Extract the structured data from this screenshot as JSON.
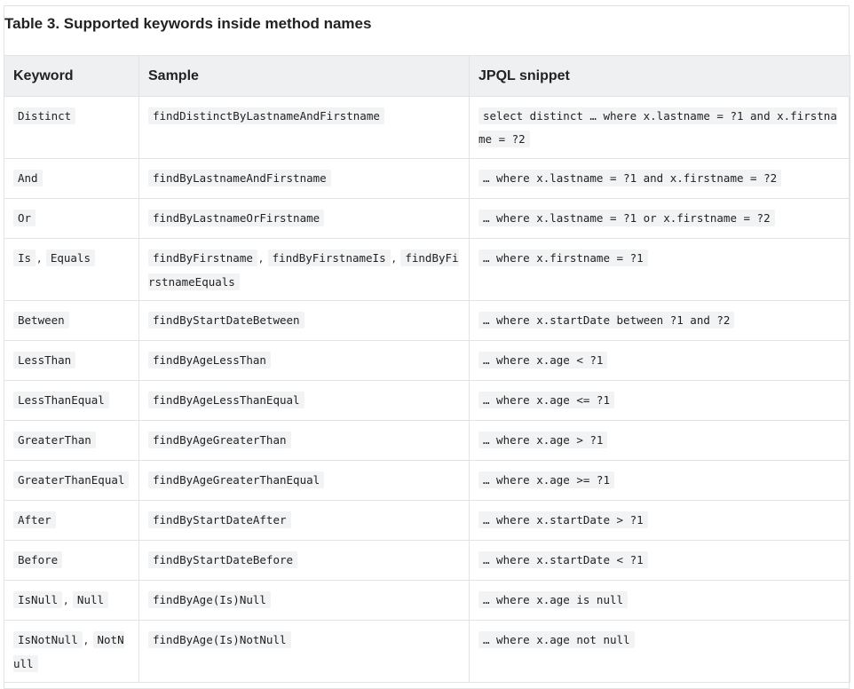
{
  "caption": "Table 3. Supported keywords inside method names",
  "headers": {
    "keyword": "Keyword",
    "sample": "Sample",
    "jpql": "JPQL snippet"
  },
  "rows": [
    {
      "keyword": [
        "Distinct"
      ],
      "sample": [
        "findDistinctByLastnameAndFirstname"
      ],
      "jpql": [
        "select distinct … where x.lastname = ?1 and x.firstname = ?2"
      ]
    },
    {
      "keyword": [
        "And"
      ],
      "sample": [
        "findByLastnameAndFirstname"
      ],
      "jpql": [
        "… where x.lastname = ?1 and x.firstname = ?2"
      ]
    },
    {
      "keyword": [
        "Or"
      ],
      "sample": [
        "findByLastnameOrFirstname"
      ],
      "jpql": [
        "… where x.lastname = ?1 or x.firstname = ?2"
      ]
    },
    {
      "keyword": [
        "Is",
        "Equals"
      ],
      "sample": [
        "findByFirstname",
        "findByFirstnameIs",
        "findByFirstnameEquals"
      ],
      "jpql": [
        "… where x.firstname = ?1"
      ]
    },
    {
      "keyword": [
        "Between"
      ],
      "sample": [
        "findByStartDateBetween"
      ],
      "jpql": [
        "… where x.startDate between ?1 and ?2"
      ]
    },
    {
      "keyword": [
        "LessThan"
      ],
      "sample": [
        "findByAgeLessThan"
      ],
      "jpql": [
        "… where x.age < ?1"
      ]
    },
    {
      "keyword": [
        "LessThanEqual"
      ],
      "sample": [
        "findByAgeLessThanEqual"
      ],
      "jpql": [
        "… where x.age <= ?1"
      ]
    },
    {
      "keyword": [
        "GreaterThan"
      ],
      "sample": [
        "findByAgeGreaterThan"
      ],
      "jpql": [
        "… where x.age > ?1"
      ]
    },
    {
      "keyword": [
        "GreaterThanEqual"
      ],
      "sample": [
        "findByAgeGreaterThanEqual"
      ],
      "jpql": [
        "… where x.age >= ?1"
      ]
    },
    {
      "keyword": [
        "After"
      ],
      "sample": [
        "findByStartDateAfter"
      ],
      "jpql": [
        "… where x.startDate > ?1"
      ]
    },
    {
      "keyword": [
        "Before"
      ],
      "sample": [
        "findByStartDateBefore"
      ],
      "jpql": [
        "… where x.startDate < ?1"
      ]
    },
    {
      "keyword": [
        "IsNull",
        "Null"
      ],
      "sample": [
        "findByAge(Is)Null"
      ],
      "jpql": [
        "… where x.age is null"
      ]
    },
    {
      "keyword": [
        "IsNotNull",
        "NotNull"
      ],
      "sample": [
        "findByAge(Is)NotNull"
      ],
      "jpql": [
        "… where x.age not null"
      ]
    }
  ],
  "separator": ","
}
